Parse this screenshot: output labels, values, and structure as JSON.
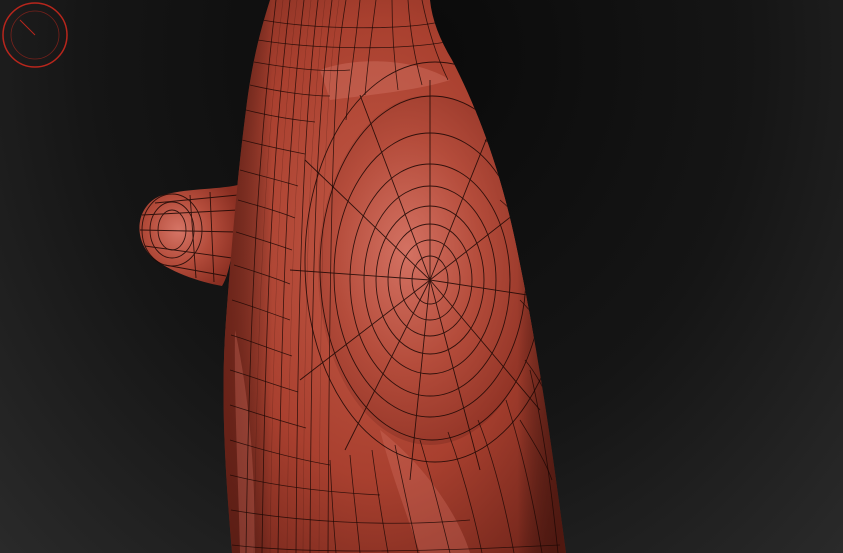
{
  "app": {
    "view": "3d-viewport",
    "background_color": "#141414",
    "mesh_color": "#a9402f",
    "mesh_highlight_color": "#d07062",
    "wireframe_color": "#1a0704",
    "gizmo_color": "#b8261c"
  },
  "viewport": {
    "polyframe_enabled": true,
    "object_icon": "sculpted-mesh-icon",
    "gizmo_icon": "axis-gizmo-icon"
  }
}
